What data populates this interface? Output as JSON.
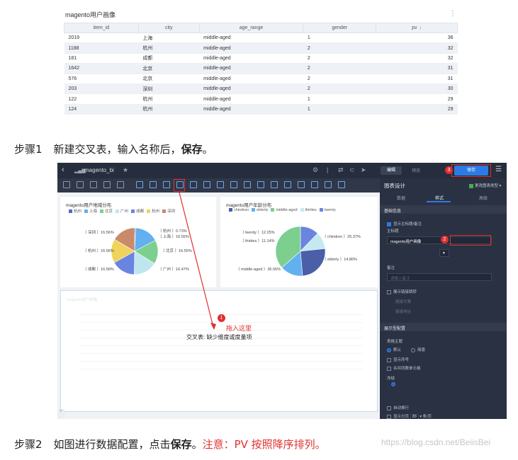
{
  "crosstab": {
    "title": "magento用户画像",
    "more": "⋮",
    "headers": [
      "item_id",
      "city",
      "age_range",
      "gender",
      "pv"
    ],
    "sort_arrow": "↓",
    "rows": [
      [
        "2019",
        "上海",
        "middle-aged",
        "1",
        "36"
      ],
      [
        "1188",
        "杭州",
        "middle-aged",
        "2",
        "32"
      ],
      [
        "181",
        "成都",
        "middle-aged",
        "2",
        "32"
      ],
      [
        "1642",
        "北京",
        "middle-aged",
        "2",
        "31"
      ],
      [
        "576",
        "北京",
        "middle-aged",
        "2",
        "31"
      ],
      [
        "203",
        "深圳",
        "middle-aged",
        "2",
        "30"
      ],
      [
        "122",
        "杭州",
        "middle-aged",
        "1",
        "29"
      ],
      [
        "124",
        "杭州",
        "middle-aged",
        "1",
        "29"
      ]
    ]
  },
  "step1": {
    "num": "步骤1",
    "text": "新建交叉表，输入名称后，",
    "bold": "保存",
    "end": "。"
  },
  "step2": {
    "num": "步骤2",
    "text": "如图进行数据配置，点击",
    "bold": "保存",
    "end": "。",
    "warn": "注意：PV 按照降序排列。"
  },
  "watermark": "https://blog.csdn.net/BeiisBei",
  "bi": {
    "back_icon": "‹",
    "app_name": "magento_bi",
    "star_icon": "★",
    "edit_label": "编辑",
    "preview_label": "预览",
    "save_label": "保存",
    "menu_icon": "☰",
    "pie1": {
      "title": "magento用户地域分布",
      "legend": [
        {
          "name": "杭州",
          "color": "#4f6bd0"
        },
        {
          "name": "上海",
          "color": "#62b0f0"
        },
        {
          "name": "北京",
          "color": "#7ccf8f"
        },
        {
          "name": "广州",
          "color": "#bfe6ef"
        },
        {
          "name": "成都",
          "color": "#6a85e0"
        },
        {
          "name": "杭州",
          "color": "#f0d35a"
        },
        {
          "name": "深圳",
          "color": "#c98a6a"
        }
      ],
      "labels": [
        "（ 杭州 ）0.73%",
        "（ 上海 ）16.55%",
        "（ 北京 ）16.55%",
        "（ 广州 ）16.47%",
        "（ 成都 ）16.58%",
        "（ 杭州 ）16.56%",
        "（ 深圳 ）16.56%"
      ]
    },
    "pie2": {
      "title": "magento用户年龄分布",
      "legend": [
        {
          "name": "chindren",
          "color": "#4a5fa8"
        },
        {
          "name": "elderly",
          "color": "#62b0f0"
        },
        {
          "name": "middle-aged",
          "color": "#7ccf8f"
        },
        {
          "name": "thirties",
          "color": "#c4e9f2"
        },
        {
          "name": "twenty",
          "color": "#6a85e0"
        }
      ],
      "labels": [
        "（ twenty ）12.25%",
        "（ thirties ）11.14%",
        "（ chindren ）25.37%",
        "（ elderly ）14.86%",
        "（ middle-aged ）36.56%"
      ]
    },
    "crosstab_ghost_title": "magento用户画像",
    "drop_hint": "拖入这里",
    "drop_hint2": "交叉表: 缺少维度或度量项",
    "badge1": "1",
    "badge2": "2",
    "badge3": "3",
    "side": {
      "title": "图表设计",
      "switch_label": "更改图表类型",
      "tabs": [
        "数据",
        "样式",
        "高级"
      ],
      "section_basic": "基础信息",
      "show_title": "显示主标题/备注",
      "main_title_label": "主标题",
      "main_title_value": "magento用户画像",
      "note_label": "备注",
      "note_placeholder": "请输入备注",
      "link_jump": "展示链接跳转",
      "link_text": "链接文案",
      "link_addr": "链接地址",
      "section_display": "展示型配置",
      "table_theme": "表格主题",
      "theme_default": "默认",
      "theme_simple": "简版",
      "show_serial": "显示序号",
      "merge_cells": "合并同数单元格",
      "freeze": "冻结",
      "auto_wrap": "自动换行",
      "pagination": "显示分页",
      "page_size": "20",
      "page_unit": "条/页"
    }
  }
}
